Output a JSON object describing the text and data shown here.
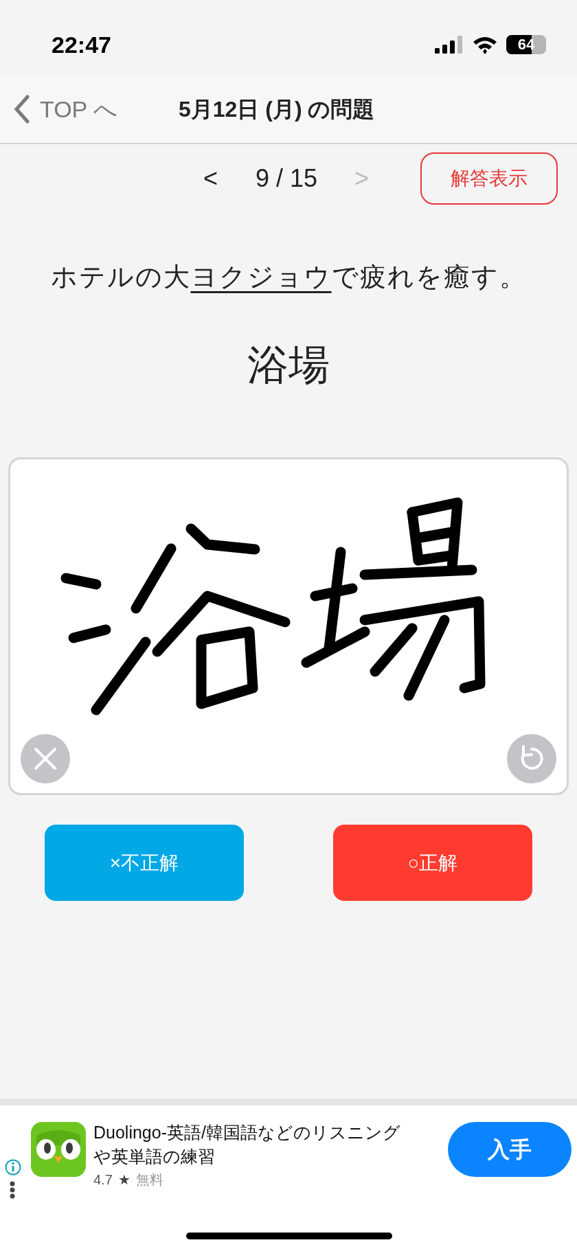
{
  "status_bar": {
    "time": "22:47",
    "battery": "64"
  },
  "nav": {
    "back": "TOP へ",
    "title": "5月12日 (月) の問題"
  },
  "pager": {
    "prev": "<",
    "position": "9 / 15",
    "next": ">",
    "prev_disabled": false,
    "next_disabled": true
  },
  "reveal_button": "解答表示",
  "question": {
    "before": "ホテルの大",
    "target": "ヨクジョウ",
    "after": "で疲れを癒す。"
  },
  "answer": "浴場",
  "buttons": [
    {
      "kind": "wrong",
      "label": "×不正解"
    },
    {
      "kind": "right",
      "label": "○正解"
    }
  ],
  "ad": {
    "title": "Duolingo-英語/韓国語などのリスニングや英単語の練習",
    "rating": "4.7",
    "star": "★",
    "price": "無料",
    "button": "入手"
  }
}
